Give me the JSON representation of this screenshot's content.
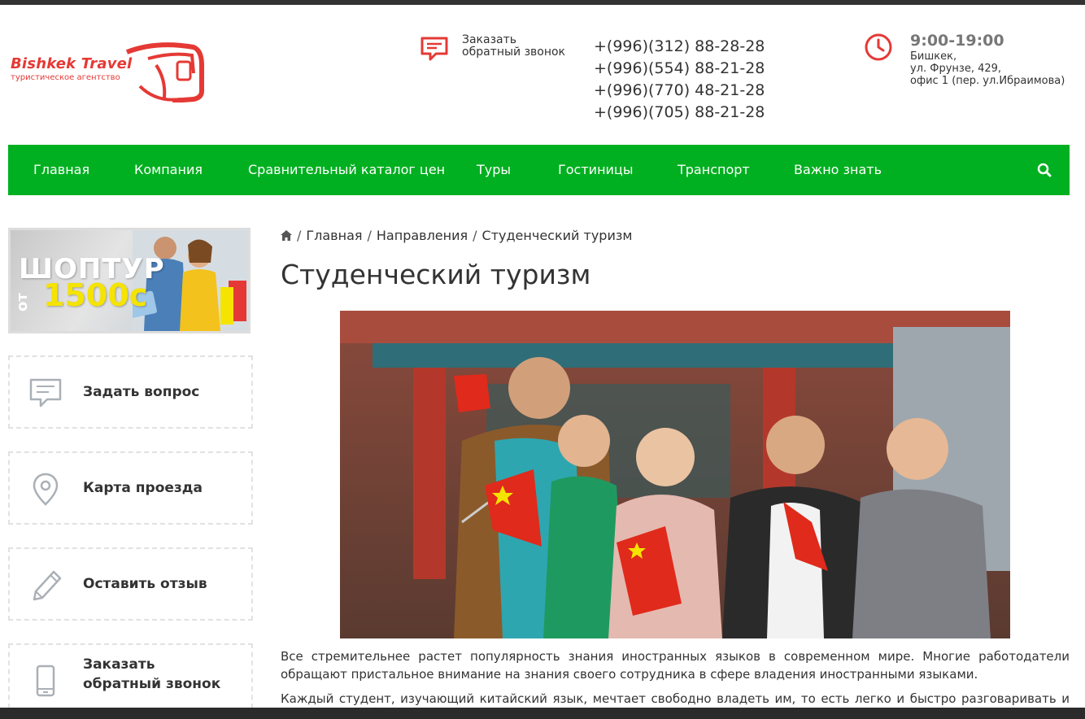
{
  "header": {
    "logo_title": "Bishkek Travel",
    "logo_subtitle": "туристическое агентство",
    "callback_line1": "Заказать",
    "callback_line2": "обратный звонок",
    "phones": [
      "+(996)(312) 88-28-28",
      "+(996)(554) 88-21-28",
      "+(996)(770) 48-21-28",
      "+(996)(705) 88-21-28"
    ],
    "hours": "9:00-19:00",
    "address_line1": "Бишкек,",
    "address_line2": "ул. Фрунзе, 429,",
    "address_line3": "офис 1 (пер. ул.Ибраимова)"
  },
  "nav": {
    "items": [
      "Главная",
      "Компания",
      "Сравнительный каталог цен",
      "Туры",
      "Гостиницы",
      "Транспорт",
      "Важно знать"
    ],
    "search_icon": "search-icon"
  },
  "sidebar": {
    "promo_title": "ШОПТУР",
    "promo_from": "от",
    "promo_price": "1500с",
    "boxes": [
      {
        "label": "Задать вопрос",
        "icon": "chat-icon"
      },
      {
        "label": "Карта проезда",
        "icon": "map-pin-icon"
      },
      {
        "label": "Оставить отзыв",
        "icon": "pencil-icon"
      },
      {
        "label_line1": "Заказать",
        "label_line2": "обратный звонок",
        "icon": "phone-icon"
      }
    ]
  },
  "breadcrumb": {
    "items": [
      "Главная",
      "Направления",
      "Студенческий туризм"
    ]
  },
  "main": {
    "title": "Студенческий туризм",
    "para1": "Все стремительнее растет популярность знания иностранных языков в современном мире. Многие работодатели обращают пристальное внимание на знания своего сотрудника в сфере владения иностранными языками.",
    "para2": "Каждый студент, изучающий китайский язык, мечтает свободно владеть им, то есть легко и быстро разговаривать и"
  },
  "colors": {
    "nav_green": "#00b020",
    "brand_red": "#e53935",
    "text": "#333333"
  }
}
